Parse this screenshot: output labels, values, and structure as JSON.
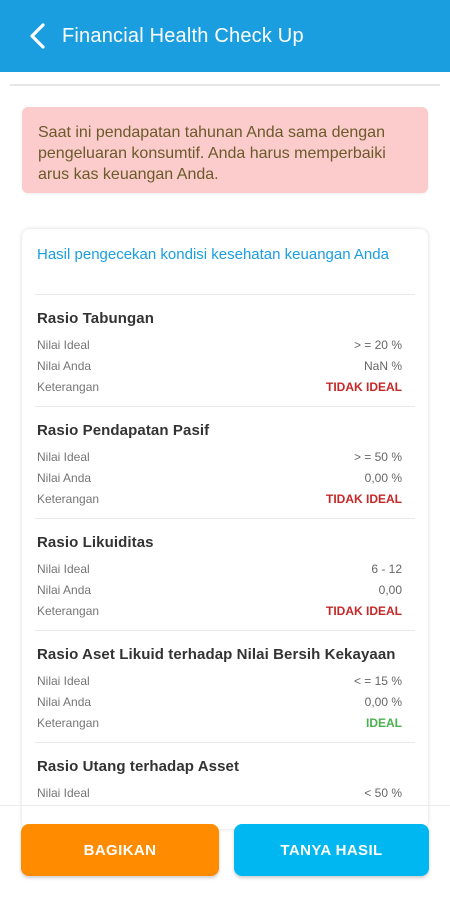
{
  "header": {
    "title": "Financial Health Check Up",
    "back_icon": "chevron-left-icon"
  },
  "alert": {
    "message": "Saat ini pendapatan tahunan Anda sama dengan pengeluaran konsumtif. Anda harus memperbaiki arus kas keuangan Anda."
  },
  "result": {
    "title": "Hasil pengecekan kondisi kesehatan keuangan Anda",
    "labels": {
      "ideal": "Nilai Ideal",
      "yours": "Nilai Anda",
      "note": "Keterangan"
    },
    "sections": [
      {
        "title": "Rasio Tabungan",
        "ideal": "> = 20 %",
        "yours": "NaN %",
        "status": "TIDAK IDEAL"
      },
      {
        "title": "Rasio Pendapatan Pasif",
        "ideal": "> = 50 %",
        "yours": "0,00 %",
        "status": "TIDAK IDEAL"
      },
      {
        "title": "Rasio Likuiditas",
        "ideal": "6 - 12",
        "yours": "0,00",
        "status": "TIDAK IDEAL"
      },
      {
        "title": "Rasio Aset Likuid terhadap Nilai Bersih Kekayaan",
        "ideal": "< = 15 %",
        "yours": "0,00 %",
        "status": "IDEAL"
      },
      {
        "title": "Rasio Utang terhadap Asset",
        "ideal": "< 50 %"
      }
    ]
  },
  "actions": {
    "share_label": "BAGIKAN",
    "ask_label": "TANYA HASIL"
  },
  "colors": {
    "appbar": "#1a9ee0",
    "alert_bg": "#fbcccb",
    "status_bad": "#c62828",
    "status_good": "#4caf50",
    "share_button": "#ff8b00",
    "ask_button": "#00b7f1"
  }
}
